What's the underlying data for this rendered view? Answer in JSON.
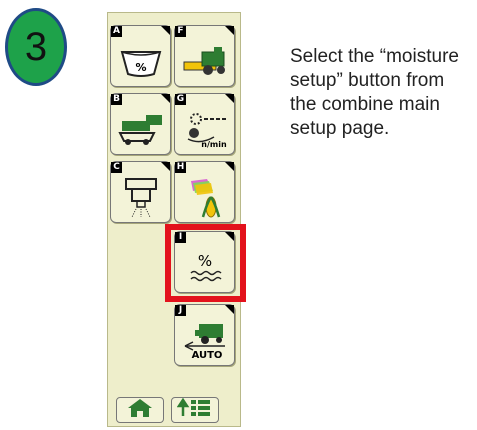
{
  "step": {
    "number": "3"
  },
  "instruction": "Select the “moisture setup” button from the combine main setup page.",
  "colors": {
    "highlight": "#e3121c",
    "badge": "#1ea24a",
    "badge_border": "#1f4b86",
    "panel": "#eeeecb",
    "deere_green": "#2e7d32",
    "deere_yellow": "#f2c40a"
  },
  "buttons": [
    {
      "key": "A",
      "icon": "grain-bin-percent-icon",
      "label": "%"
    },
    {
      "key": "F",
      "icon": "combine-header-icon"
    },
    {
      "key": "B",
      "icon": "combine-setup-icon"
    },
    {
      "key": "G",
      "icon": "shaft-speed-icon",
      "label": "n/min"
    },
    {
      "key": "C",
      "icon": "grain-cleaning-icon"
    },
    {
      "key": "H",
      "icon": "crop-type-icon"
    },
    {
      "key": "I",
      "icon": "moisture-setup-icon",
      "label": "%"
    },
    {
      "key": "J",
      "icon": "auto-combine-icon",
      "label": "AUTO"
    }
  ],
  "nav": [
    {
      "icon": "home-icon"
    },
    {
      "icon": "menu-list-icon"
    }
  ]
}
